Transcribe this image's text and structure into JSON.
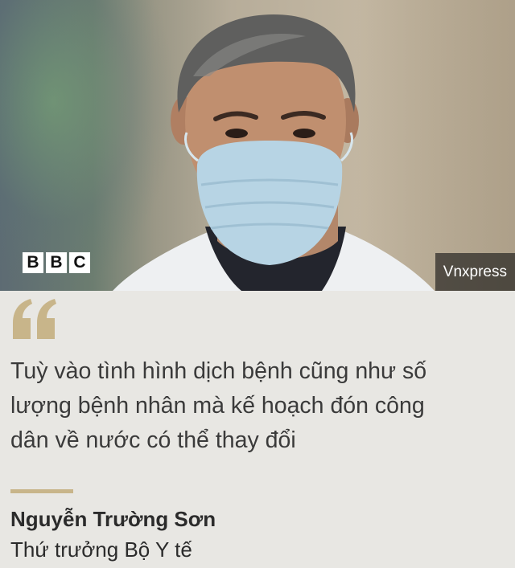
{
  "photo": {
    "logo_letters": [
      "B",
      "B",
      "C"
    ],
    "credit": "Vnxpress"
  },
  "quote": {
    "lines": [
      "Tuỳ vào tình hình dịch bệnh cũng như số",
      "lượng bệnh nhân mà kế hoạch đón công",
      "dân về nước có thể thay đổi"
    ],
    "author": "Nguyễn Trường Sơn",
    "role": "Thứ trưởng Bộ Y tế"
  },
  "colors": {
    "background": "#e8e7e3",
    "accent": "#c8b58a",
    "text": "#3a3a3a"
  },
  "icons": [
    "quote-icon"
  ]
}
